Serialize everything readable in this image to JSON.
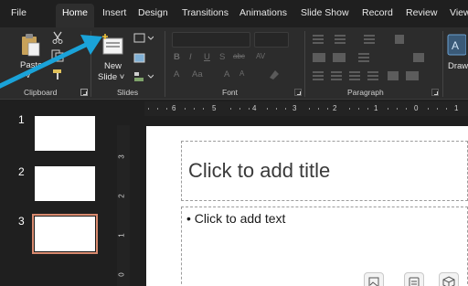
{
  "tabs": [
    "File",
    "Home",
    "Insert",
    "Design",
    "Transitions",
    "Animations",
    "Slide Show",
    "Record",
    "Review",
    "View"
  ],
  "ribbon": {
    "clipboard": {
      "paste_label": "Paste",
      "label": "Clipboard"
    },
    "slides": {
      "new_slide_line1": "New",
      "new_slide_line2": "Slide ˅",
      "label": "Slides"
    },
    "font": {
      "label": "Font",
      "bold": "B",
      "italic": "I",
      "underline": "U",
      "strike": "S",
      "abc": "abc",
      "av": "AV",
      "font_color": "A",
      "case": "Aa",
      "grow": "A",
      "shrink": "A"
    },
    "paragraph": {
      "label": "Paragraph"
    },
    "drawing": {
      "label": "Draw"
    }
  },
  "ruler": {
    "h_numbers": [
      "6",
      "5",
      "4",
      "3",
      "2",
      "1",
      "0",
      "1"
    ],
    "v_numbers": [
      "3",
      "2",
      "1",
      "0"
    ]
  },
  "thumbnails": [
    {
      "number": "1"
    },
    {
      "number": "2"
    },
    {
      "number": "3"
    }
  ],
  "slide": {
    "title_placeholder": "Click to add title",
    "body_placeholder": "• Click to add text"
  },
  "colors": {
    "arrow": "#1aa3d9",
    "selected_thumb_border": "#d98a6f",
    "tab_active_bg": "#2e2e2e"
  }
}
